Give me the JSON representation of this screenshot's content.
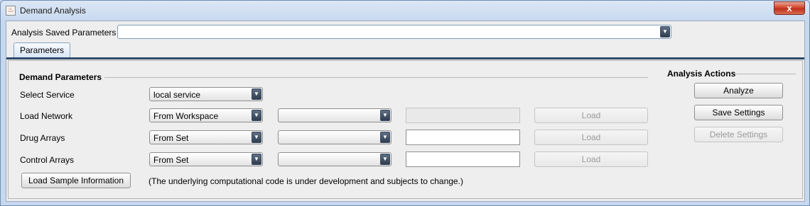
{
  "window": {
    "title": "Demand Analysis",
    "close_label": "x"
  },
  "top": {
    "analysis_label": "Analysis",
    "saved_label": "Saved Parameters",
    "saved_value": ""
  },
  "tabs": [
    {
      "label": "Parameters"
    }
  ],
  "demand": {
    "title": "Demand Parameters",
    "rows": [
      {
        "label": "Select Service",
        "combo1": "local service"
      },
      {
        "label": "Load Network",
        "combo1": "From Workspace",
        "combo2": "",
        "field": "",
        "load": "Load"
      },
      {
        "label": "Drug Arrays",
        "combo1": "From Set",
        "combo2": "",
        "field": "",
        "load": "Load"
      },
      {
        "label": "Control Arrays",
        "combo1": "From Set",
        "combo2": "",
        "field": "",
        "load": "Load"
      }
    ],
    "sample_button": "Load Sample Information",
    "note": "(The underlying computational code is under development and subjects to change.)"
  },
  "actions": {
    "title": "Analysis Actions",
    "analyze": "Analyze",
    "save": "Save Settings",
    "delete": "Delete Settings"
  },
  "icons": {
    "app": "java-app-icon",
    "close": "close-icon",
    "dropdown": "chevron-down-icon"
  }
}
